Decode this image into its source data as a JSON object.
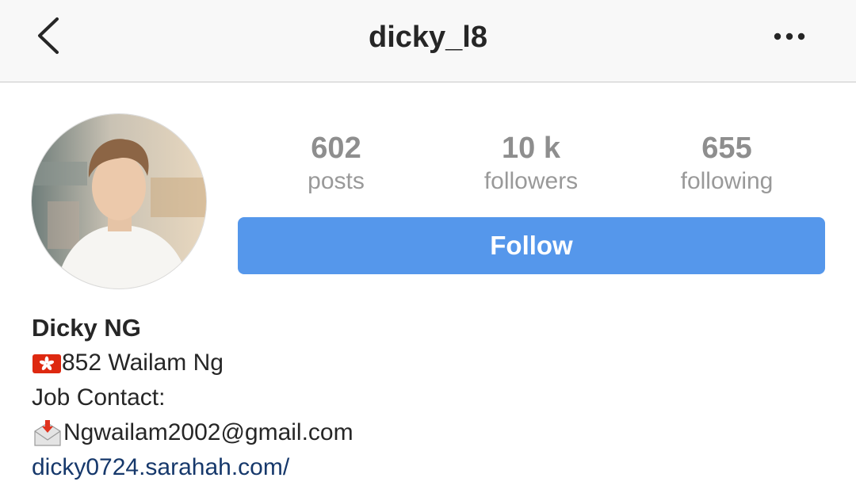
{
  "header": {
    "username": "dicky_l8"
  },
  "stats": {
    "posts": {
      "value": "602",
      "label": "posts"
    },
    "followers": {
      "value": "10 k",
      "label": "followers"
    },
    "following": {
      "value": "655",
      "label": "following"
    }
  },
  "actions": {
    "follow_label": "Follow"
  },
  "bio": {
    "display_name": "Dicky NG",
    "line1_text": "852 Wailam Ng",
    "line1_icon": "hong-kong-flag-icon",
    "line2_text": "Job Contact:",
    "line3_text": "Ngwailam2002@gmail.com",
    "line3_icon": "envelope-arrow-icon",
    "website": "dicky0724.sarahah.com/"
  },
  "colors": {
    "follow_button": "#5597eb",
    "link": "#16386b",
    "stat_text": "#8e8e8e",
    "header_bg": "#f8f8f8"
  }
}
